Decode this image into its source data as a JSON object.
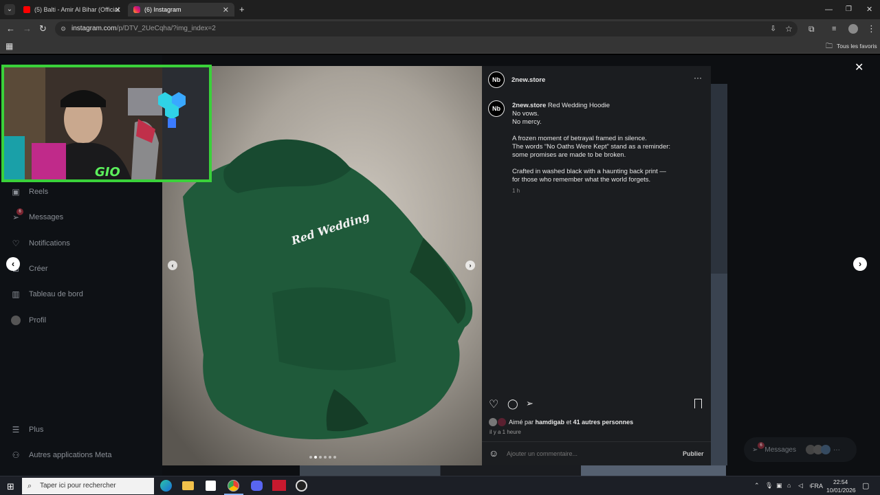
{
  "browser": {
    "tabs": [
      {
        "label": "(5) Balti - Amir Al Bihar (Official"
      },
      {
        "label": "(6) Instagram"
      }
    ],
    "url_host": "instagram.com",
    "url_path": "/p/DTV_2UeCqha/?img_index=2",
    "bookmarks_label": "Tous les favoris"
  },
  "sidebar": {
    "items": [
      {
        "label": "Reels",
        "icon": "reels-icon"
      },
      {
        "label": "Messages",
        "icon": "messages-icon",
        "badge": "6"
      },
      {
        "label": "Notifications",
        "icon": "heart-icon"
      },
      {
        "label": "Créer",
        "icon": "plus-icon"
      },
      {
        "label": "Tableau de bord",
        "icon": "chart-icon"
      },
      {
        "label": "Profil",
        "icon": "avatar-icon"
      },
      {
        "label": "Plus",
        "icon": "menu-icon"
      },
      {
        "label": "Autres applications Meta",
        "icon": "meta-icon"
      }
    ]
  },
  "post": {
    "username": "2new.store",
    "avatar_text": "Nb",
    "caption_title": "Red Wedding Hoodie",
    "caption_lines": [
      "No vows.",
      "No mercy.",
      "",
      "A frozen moment of betrayal framed in silence.",
      "The words “No Oaths Were Kept” stand as a reminder:",
      "some promises are made to be broken.",
      "",
      "Crafted in washed black with a haunting back print —",
      "for those who remember what the world forgets."
    ],
    "caption_time": "1 h",
    "likes_prefix": "Aimé par",
    "likes_user": "hamdigab",
    "likes_joiner": "et",
    "likes_others": "41 autres personnes",
    "post_time": "il y a 1 heure",
    "comment_placeholder": "Ajouter un commentaire...",
    "publish_label": "Publier",
    "print_text": "Red Wedding",
    "carousel_dots": 6,
    "carousel_active": 1
  },
  "messages_float": {
    "label": "Messages",
    "badge": "6"
  },
  "taskbar": {
    "search_placeholder": "Taper ici pour rechercher",
    "lang": "FRA",
    "time": "22:54",
    "date": "10/01/2026"
  },
  "colors": {
    "webcam_border": "#3ad13a",
    "hoodie": "#1f5a3a",
    "like_accent": "#ff3040"
  }
}
